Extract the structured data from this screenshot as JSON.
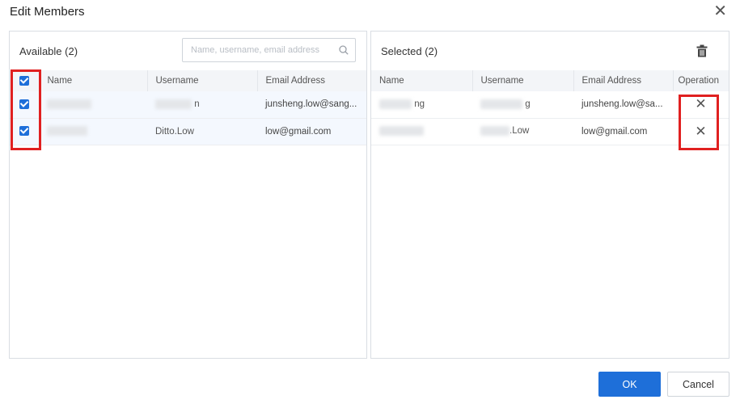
{
  "dialog": {
    "title": "Edit Members",
    "close_glyph": "✕"
  },
  "available": {
    "title": "Available (2)",
    "search_placeholder": "Name, username, email address",
    "columns": [
      "Name",
      "Username",
      "Email Address"
    ],
    "rows": [
      {
        "checked": true,
        "name": "",
        "username_tail": "n",
        "email": "junsheng.low@sang..."
      },
      {
        "checked": true,
        "name": "",
        "username_tail": "Ditto.Low",
        "email": "low@gmail.com"
      }
    ]
  },
  "selected": {
    "title": "Selected (2)",
    "columns": [
      "Name",
      "Username",
      "Email Address",
      "Operation"
    ],
    "rows": [
      {
        "name_tail": "ng",
        "username_tail": "g",
        "email": "junsheng.low@sa...",
        "operation": "✕"
      },
      {
        "name_tail": "",
        "username_tail": ".Low",
        "email": "low@gmail.com",
        "operation": "✕"
      }
    ]
  },
  "footer": {
    "ok_label": "OK",
    "cancel_label": "Cancel"
  },
  "icons": {
    "search": "search-icon",
    "trash": "trash-icon",
    "close": "close-icon",
    "remove": "remove-icon"
  },
  "colors": {
    "primary": "#1e6fd9",
    "highlight": "#e02020",
    "header_bg": "#f3f5f8",
    "row_selected_bg": "#f4f8fe"
  }
}
